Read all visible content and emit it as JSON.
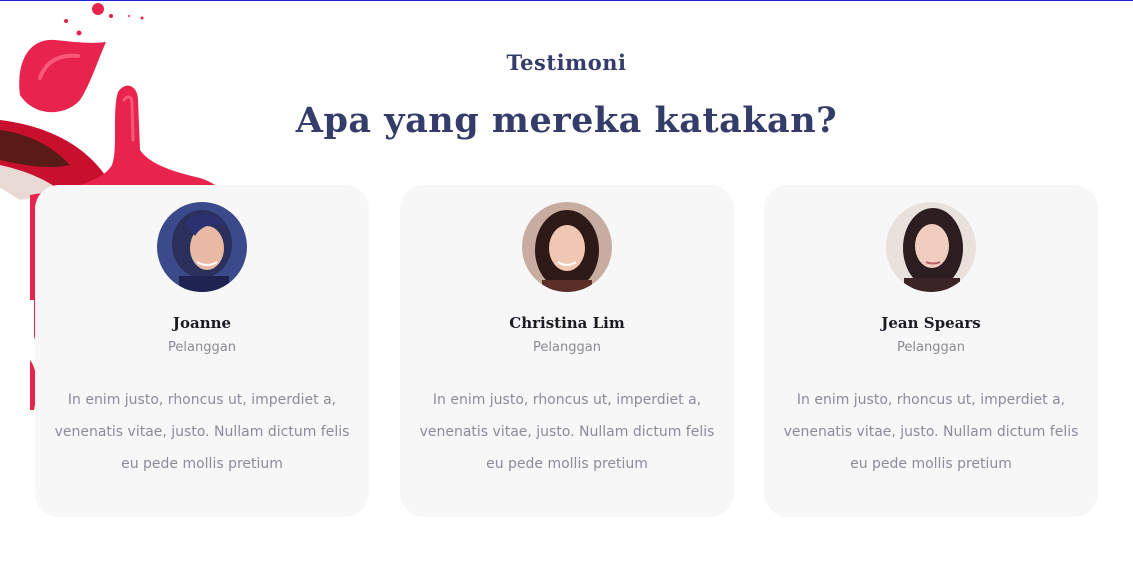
{
  "section": {
    "eyebrow": "Testimoni",
    "headline": "Apa yang mereka katakan?"
  },
  "testimonials": [
    {
      "name": "Joanne",
      "role": "Pelanggan",
      "quote": "In enim justo, rhoncus ut, imperdiet a, venenatis vitae, justo. Nullam dictum felis eu pede mollis pretium"
    },
    {
      "name": "Christina Lim",
      "role": "Pelanggan",
      "quote": "In enim justo, rhoncus ut, imperdiet a, venenatis vitae, justo. Nullam dictum felis eu pede mollis pretium"
    },
    {
      "name": "Jean Spears",
      "role": "Pelanggan",
      "quote": "In enim justo, rhoncus ut, imperdiet a, venenatis vitae, justo. Nullam dictum felis eu pede mollis pretium"
    }
  ],
  "colors": {
    "heading": "#343c6a",
    "splash": "#e8234d",
    "card_bg": "#f7f7f7",
    "top_border": "#1f24d6"
  }
}
